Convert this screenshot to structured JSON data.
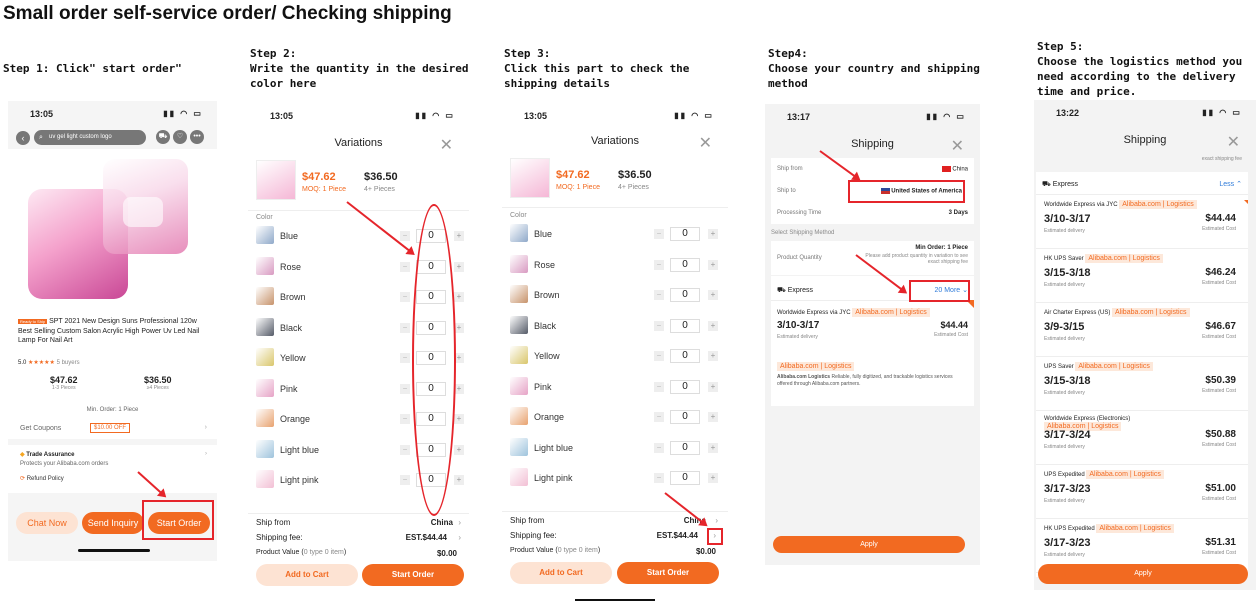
{
  "title": "Small order self-service order/ Checking shipping",
  "steps": [
    "Step 1: Click\" start order\"",
    "Step 2:\nWrite the quantity in the desired\ncolor here",
    "Step 3:\nClick this part to check the\nshipping details",
    "Step4:\nChoose your country and shipping\nmethod",
    "Step 5:\nChoose the logistics method you\nneed according to the delivery\ntime and price."
  ],
  "p1": {
    "time": "13:05",
    "search": "uv gel light custom logo",
    "badge": "Ready to Ship",
    "product": "SPT 2021 New Design Suns Professional 120w Best Selling Custom Salon Acrylic High Power Uv Led Nail Lamp For Nail Art",
    "rating": "5.0",
    "stars": "★★★★★",
    "buyers": "5 buyers",
    "price1": "$47.62",
    "range1": "1-3 Pieces",
    "price2": "$36.50",
    "range2": "≥4 Pieces",
    "min": "Min. Order: 1 Piece",
    "coupons": "Get Coupons",
    "coupon": "$10.00 OFF",
    "ta": "Trade Assurance",
    "ta_sub": "Protects your Alibaba.com orders",
    "refund": "Refund Policy",
    "chat": "Chat Now",
    "inquiry": "Send Inquiry",
    "start": "Start Order"
  },
  "var": {
    "time": "13:05",
    "title": "Variations",
    "price_o": "$47.62",
    "moq": "MOQ: 1 Piece",
    "price": "$36.50",
    "pieces": "4+ Pieces",
    "color": "Color",
    "colors": [
      "Blue",
      "Rose",
      "Brown",
      "Black",
      "Yellow",
      "Pink",
      "Orange",
      "Light blue",
      "Light pink"
    ],
    "qty": "0",
    "ship_from": "Ship from",
    "china": "China",
    "ship_fee": "Shipping fee:",
    "est": "EST.$44.44",
    "pv": "Product Value (",
    "pv2": "0 type 0 item",
    "pv3": ")",
    "pvv": "$0.00",
    "cart": "Add to Cart",
    "start": "Start Order"
  },
  "p4": {
    "time": "13:17",
    "title": "Shipping",
    "ship_from": "Ship from",
    "china": "China",
    "ship_to": "Ship to",
    "usa": "United States of America",
    "proc": "Processing Time",
    "days": "3 Days",
    "select": "Select Shipping Method",
    "min": "Min Order: 1 Piece",
    "pq": "Product Quantity",
    "pq_note": "Please add product quantity in variation to see exact shipping fee",
    "express": "Express",
    "more": "20 More",
    "we": "Worldwide Express via JYC",
    "tag": "Alibaba.com | Logistics",
    "date": "3/10-3/17",
    "cost": "$44.44",
    "ed": "Estimated delivery",
    "ec": "Estimated Cost",
    "log_tag": "Alibaba.com | Logistics",
    "log_b": "Alibaba.com Logistics",
    "log_d": "Reliable, fully digitized, and trackable logistics services offered through Alibaba.com partners.",
    "apply": "Apply"
  },
  "p5": {
    "time": "13:22",
    "title": "Shipping",
    "top_note": "exact shipping fee",
    "express": "Express",
    "less": "Less",
    "ed": "Estimated delivery",
    "ec": "Estimated Cost",
    "tag": "Alibaba.com | Logistics",
    "apply": "Apply",
    "methods": [
      {
        "name": "Worldwide Express via JYC",
        "date": "3/10-3/17",
        "cost": "$44.44"
      },
      {
        "name": "HK UPS Saver",
        "date": "3/15-3/18",
        "cost": "$46.24"
      },
      {
        "name": "Air Charter Express (US)",
        "date": "3/9-3/15",
        "cost": "$46.67"
      },
      {
        "name": "UPS Saver",
        "date": "3/15-3/18",
        "cost": "$50.39"
      },
      {
        "name": "Worldwide Express (Electronics)",
        "date": "3/17-3/24",
        "cost": "$50.88"
      },
      {
        "name": "UPS Expedited",
        "date": "3/17-3/23",
        "cost": "$51.00"
      },
      {
        "name": "HK UPS Expedited",
        "date": "3/17-3/23",
        "cost": "$51.31"
      }
    ]
  },
  "colors": {
    "accent": "#f26a21",
    "annot": "#e5252b"
  }
}
